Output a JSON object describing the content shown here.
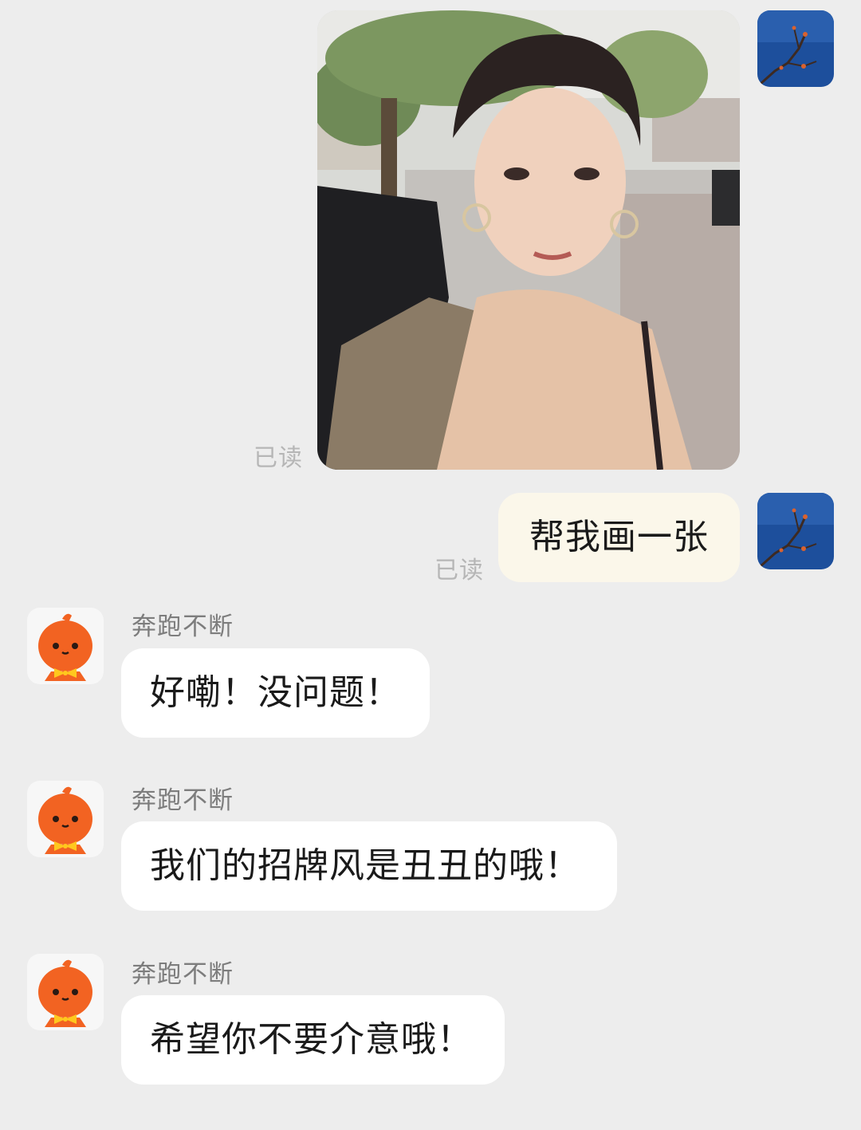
{
  "messages": [
    {
      "direction": "outgoing",
      "type": "image",
      "read_status": "已读",
      "image_icon": "photo-icon"
    },
    {
      "direction": "outgoing",
      "type": "text",
      "text": "帮我画一张",
      "read_status": "已读"
    },
    {
      "direction": "incoming",
      "type": "text",
      "sender": "奔跑不断",
      "text": "好嘞！没问题！"
    },
    {
      "direction": "incoming",
      "type": "text",
      "sender": "奔跑不断",
      "text": "我们的招牌风是丑丑的哦！"
    },
    {
      "direction": "incoming",
      "type": "text",
      "sender": "奔跑不断",
      "text": "希望你不要介意哦！"
    }
  ],
  "colors": {
    "background": "#ededed",
    "outgoing_bubble": "#fbf7ea",
    "incoming_bubble": "#ffffff",
    "bot_avatar_orange": "#f26322",
    "bot_bowtie": "#ffc81e",
    "user_avatar_blue": "#1d4f9c"
  },
  "icons": {
    "user_avatar": "sky-branch-avatar-icon",
    "bot_avatar": "orange-mascot-avatar-icon"
  }
}
